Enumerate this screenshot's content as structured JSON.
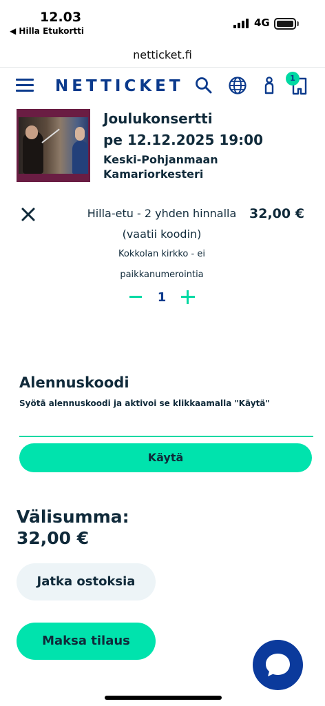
{
  "status_bar": {
    "time": "12.03",
    "back_app": "◀ Hilla Etukortti",
    "network": "4G"
  },
  "browser": {
    "url": "netticket.fi"
  },
  "header": {
    "logo": "NETTICKET",
    "cart_count": "1",
    "brand_color": "#0b3a8c",
    "accent_color": "#00d9a3"
  },
  "event": {
    "title": "Joulukonsertti",
    "datetime": "pe 12.12.2025 19:00",
    "organizer_line1": "Keski-Pohjanmaan",
    "organizer_line2": "Kamariorkesteri"
  },
  "ticket": {
    "name_line1": "Hilla-etu - 2 yhden hinnalla",
    "name_line2": "(vaatii koodin)",
    "price": "32,00 €",
    "venue_line1": "Kokkolan kirkko - ei",
    "venue_line2": "paikkanumerointia",
    "quantity": "1"
  },
  "discount": {
    "title": "Alennuskoodi",
    "help": "Syötä alennuskoodi ja aktivoi se klikkaamalla \"Käytä\"",
    "input_value": "",
    "apply_label": "Käytä"
  },
  "summary": {
    "subtotal_label": "Välisumma:",
    "subtotal_value": "32,00 €"
  },
  "actions": {
    "continue_label": "Jatka ostoksia",
    "pay_label": "Maksa tilaus"
  }
}
